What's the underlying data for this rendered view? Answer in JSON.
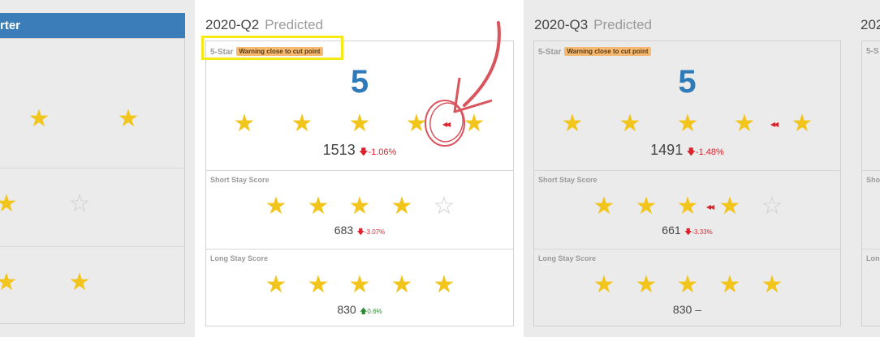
{
  "left_column": {
    "header_label": "rter",
    "rows": [
      {
        "stars": [
          1,
          1
        ]
      },
      {
        "stars": [
          1,
          0
        ]
      },
      {
        "stars": [
          1,
          1
        ]
      }
    ]
  },
  "columns": [
    {
      "quarter": "2020-Q2",
      "status": "Predicted",
      "five_star": {
        "label": "5-Star",
        "badge": "Warning close to cut point",
        "rating": "5",
        "stars": [
          1,
          1,
          1,
          1,
          1
        ],
        "score": "1513",
        "change": "-1.06%",
        "direction": "down"
      },
      "short_stay": {
        "label": "Short Stay Score",
        "stars": [
          1,
          1,
          1,
          1,
          0
        ],
        "score": "683",
        "change": "-3.07%",
        "direction": "down"
      },
      "long_stay": {
        "label": "Long Stay Score",
        "stars": [
          1,
          1,
          1,
          1,
          1
        ],
        "score": "830",
        "change": "0.6%",
        "direction": "up"
      }
    },
    {
      "quarter": "2020-Q3",
      "status": "Predicted",
      "five_star": {
        "label": "5-Star",
        "badge": "Warning close to cut point",
        "rating": "5",
        "stars": [
          1,
          1,
          1,
          1,
          1
        ],
        "score": "1491",
        "change": "-1.48%",
        "direction": "down"
      },
      "short_stay": {
        "label": "Short Stay Score",
        "stars": [
          1,
          1,
          1,
          1,
          0
        ],
        "score": "661",
        "change": "-3.33%",
        "direction": "down"
      },
      "long_stay": {
        "label": "Long Stay Score",
        "stars": [
          1,
          1,
          1,
          1,
          1
        ],
        "score": "830",
        "change": "–",
        "direction": "none"
      }
    }
  ],
  "right_partial": {
    "quarter_fragment": "202",
    "five_star_fragment": "5-S",
    "short_fragment": "Sho",
    "long_fragment": "Long"
  },
  "icons": {
    "star": "★",
    "empty_star": "☆",
    "arrow_down": "🡇",
    "arrow_up": "🡅",
    "near_cut_arrow": "◂◂"
  },
  "colors": {
    "header_blue": "#3a7db9",
    "star_gold": "#f2c51d",
    "rating_blue": "#2f7ab8",
    "negative": "#e0202a",
    "positive": "#2e8b36",
    "badge_orange": "#f5b971",
    "annotation_yellow": "#f5ea17",
    "annotation_red": "#d9545c"
  }
}
